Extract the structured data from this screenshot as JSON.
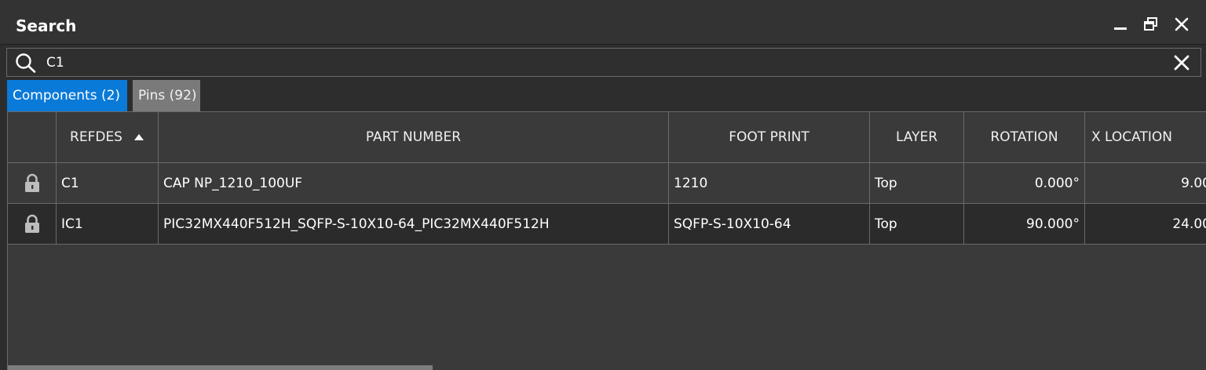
{
  "window": {
    "title": "Search",
    "controls": {
      "minimize": "minimize-icon",
      "restore": "restore-icon",
      "close": "close-icon"
    }
  },
  "search": {
    "icon": "search-icon",
    "value": "C1",
    "clear_icon": "close-icon"
  },
  "tabs": [
    {
      "label": "Components (2)",
      "active": true
    },
    {
      "label": "Pins (92)",
      "active": false
    }
  ],
  "table": {
    "columns": {
      "lock": "",
      "refdes": "REFDES",
      "part_number": "PART NUMBER",
      "foot_print": "FOOT PRINT",
      "layer": "LAYER",
      "rotation": "ROTATION",
      "x_location": "X LOCATION"
    },
    "sort": {
      "column": "refdes",
      "direction": "ascending"
    },
    "rows": [
      {
        "lock_icon": "lock-icon",
        "refdes": "C1",
        "part_number": "CAP NP_1210_100UF",
        "foot_print": "1210",
        "layer": "Top",
        "rotation": "0.000°",
        "x_location": "9.00"
      },
      {
        "lock_icon": "lock-icon",
        "refdes": "IC1",
        "part_number": "PIC32MX440F512H_SQFP-S-10X10-64_PIC32MX440F512H",
        "foot_print": "SQFP-S-10X10-64",
        "layer": "Top",
        "rotation": "90.000°",
        "x_location": "24.00"
      }
    ]
  },
  "colors": {
    "background": "#2d2d2d",
    "active_tab": "#0a7ad8",
    "inactive_tab": "#7a7a7a",
    "grid_line": "#6a6a6a"
  }
}
